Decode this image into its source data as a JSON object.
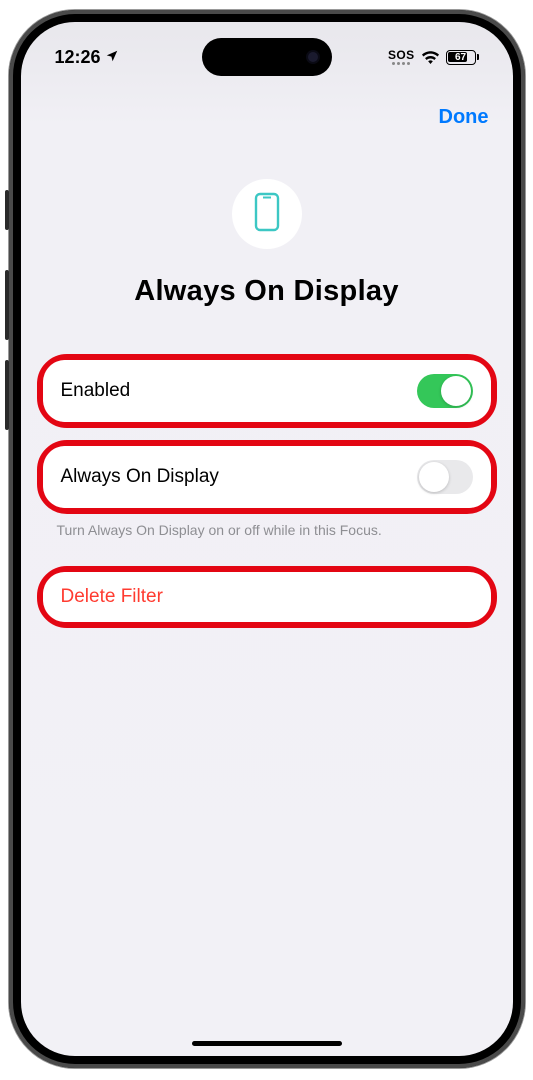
{
  "status_bar": {
    "time": "12:26",
    "sos": "SOS",
    "battery_level": "67"
  },
  "nav": {
    "done_label": "Done"
  },
  "header": {
    "title": "Always On Display"
  },
  "rows": {
    "enabled": {
      "label": "Enabled",
      "on": true
    },
    "aod": {
      "label": "Always On Display",
      "on": false
    },
    "aod_footer": "Turn Always On Display on or off while in this Focus.",
    "delete": {
      "label": "Delete Filter"
    }
  }
}
